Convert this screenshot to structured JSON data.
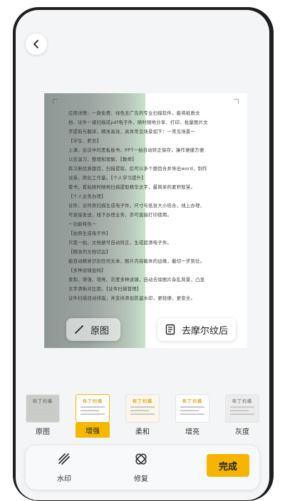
{
  "document": {
    "lines": [
      "应用详情：一款免费、绿色无广告的专业扫描软件，能将纸质文",
      "档、证件一键扫描成pdf电子件，随时随地分享、打印、批量图片文",
      "字提取与翻译，精准高效，具体常见场景如下：一常见场景一",
      "【学生、职员】",
      "上课、会议中的黑板板书、PPT一拍自动矫正保存，操作便捷方便",
      "以后温习、整理和理解。【教师】",
      "练习册优质题目，扫描提取，后可以多个题目合并导出word，制作",
      "试卷、简化工作量。【个人学习提升】",
      "看书，看贴随时随地扫描提取精华文字，最简单的素积智慧。",
      "【个人业务办理】",
      "证件、证件照扫描生成电子件，尺寸与纸张大小结合，线上办理、",
      "可直接发送，线下办理业务，亦可直接打印使用。",
      "一功能特色一",
      "【拍照生成电子件】",
      "只需一拍，文档便可自动矫正，生成超清电子件。",
      "【精准的文档切边】",
      "能自动精准识别任何文本、图片内容载体的边缘，截切一步到位。",
      "【多种滤镜加持】",
      "柔和、增强、增亮、灰度多种滤镜，自动去除图片杂乱背景，凸显",
      "文字清晰对比度。【证件扫描管理】",
      "证件扫描自动排版，并支持添加防盗水印，更轻便、更安全。"
    ]
  },
  "compare": {
    "original_label": "原图",
    "after_label": "去摩尔纹后"
  },
  "filters": [
    {
      "label": "原图",
      "thumb_title": "布丁扫描"
    },
    {
      "label": "增强",
      "thumb_title": "布丁扫描"
    },
    {
      "label": "柔和",
      "thumb_title": "布丁扫描"
    },
    {
      "label": "增亮",
      "thumb_title": "布丁扫描"
    },
    {
      "label": "灰度",
      "thumb_title": "布丁扫描"
    }
  ],
  "toolbar": {
    "watermark_label": "水印",
    "repair_label": "修复",
    "done_label": "完成"
  },
  "colors": {
    "accent": "#f7b500",
    "background": "#f4f5f6"
  },
  "icons": {
    "back": "chevron-left-icon",
    "pen": "pen-icon",
    "document": "document-icon",
    "watermark": "watermark-icon",
    "repair": "repair-icon"
  }
}
